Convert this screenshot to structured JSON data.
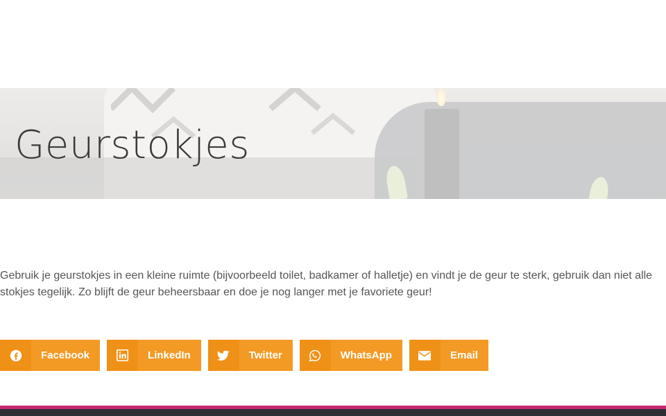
{
  "hero": {
    "title": "Geurstokjes"
  },
  "content": {
    "paragraph": "Gebruik je geurstokjes in een kleine ruimte (bijvoorbeeld toilet, badkamer of halletje) en vindt je de geur te sterk, gebruik dan niet alle stokjes tegelijk. Zo blijft de geur beheersbaar en doe je nog langer met je favoriete geur!"
  },
  "share": {
    "buttons": [
      {
        "label": "Facebook",
        "icon": "facebook-icon"
      },
      {
        "label": "LinkedIn",
        "icon": "linkedin-icon"
      },
      {
        "label": "Twitter",
        "icon": "twitter-icon"
      },
      {
        "label": "WhatsApp",
        "icon": "whatsapp-icon"
      },
      {
        "label": "Email",
        "icon": "envelope-icon"
      }
    ]
  },
  "colors": {
    "share_button": "#f39a25",
    "share_icon_bg": "#ef9117",
    "footer_accent": "#c52a70",
    "footer_bar": "#2d2f33",
    "body_text": "#555555"
  }
}
